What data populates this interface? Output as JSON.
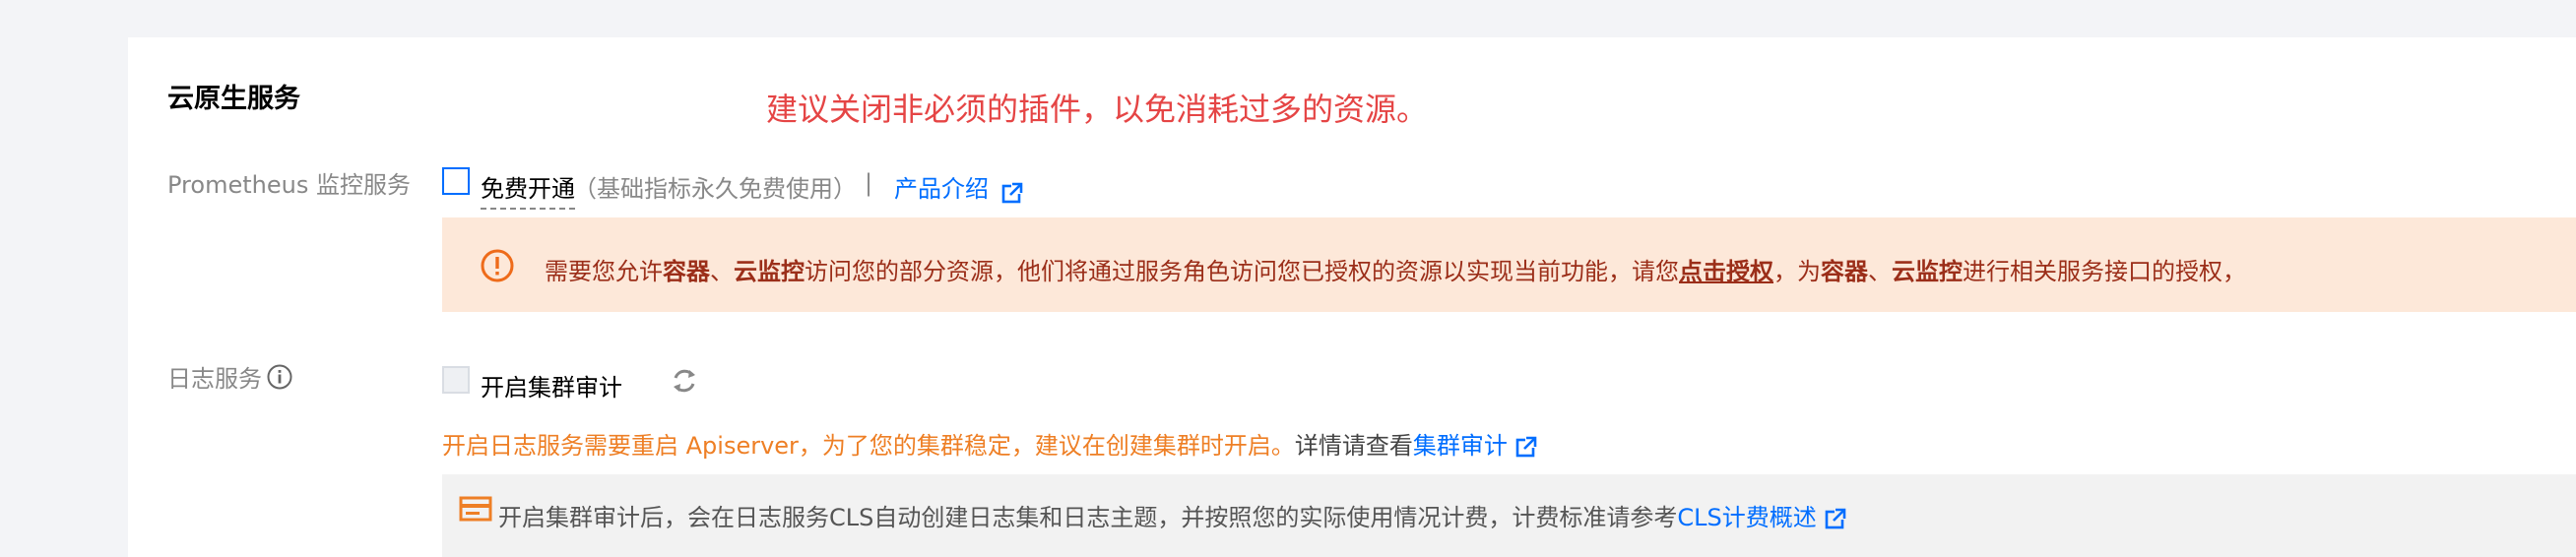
{
  "section": {
    "title": "云原生服务",
    "recommendation": "建议关闭非必须的插件，以免消耗过多的资源。"
  },
  "prometheus": {
    "label": "Prometheus 监控服务",
    "checkbox_label": "免费开通",
    "note": "（基础指标永久免费使用）",
    "divider": "|",
    "product_link": "产品介绍",
    "checked": false
  },
  "alert": {
    "icon": "exclamation-circle-icon",
    "prefix": "需要您允许",
    "service1": "容器",
    "sep1": "、",
    "service2": "云监控",
    "middle": "访问您的部分资源，他们将通过服务角色访问您已授权的资源以实现当前功能，请您",
    "auth_link": "点击授权",
    "middle2": "，为",
    "service3": "容器",
    "sep2": "、",
    "service4": "云监控",
    "suffix": "进行相关服务接口的授权，",
    "background": "#fde8d9",
    "text_color": "#9b2e19"
  },
  "log_service": {
    "label": "日志服务",
    "info_icon": "info-circle-icon",
    "audit_label": "开启集群审计",
    "refresh_icon": "refresh-icon",
    "checked": false,
    "restart_note": "开启日志服务需要重启 Apiserver，为了您的集群稳定，建议在创建集群时开启。",
    "details_prefix": "详情请查看",
    "details_link": "集群审计",
    "billing_icon": "billing-icon",
    "billing_text": "开启集群审计后，会在日志服务CLS自动创建日志集和日志主题，并按照您的实际使用情况计费，计费标准请参考",
    "billing_link": "CLS计费概述"
  },
  "colors": {
    "link": "#006eff",
    "warning_red": "#e54545",
    "orange": "#ee7f25"
  }
}
